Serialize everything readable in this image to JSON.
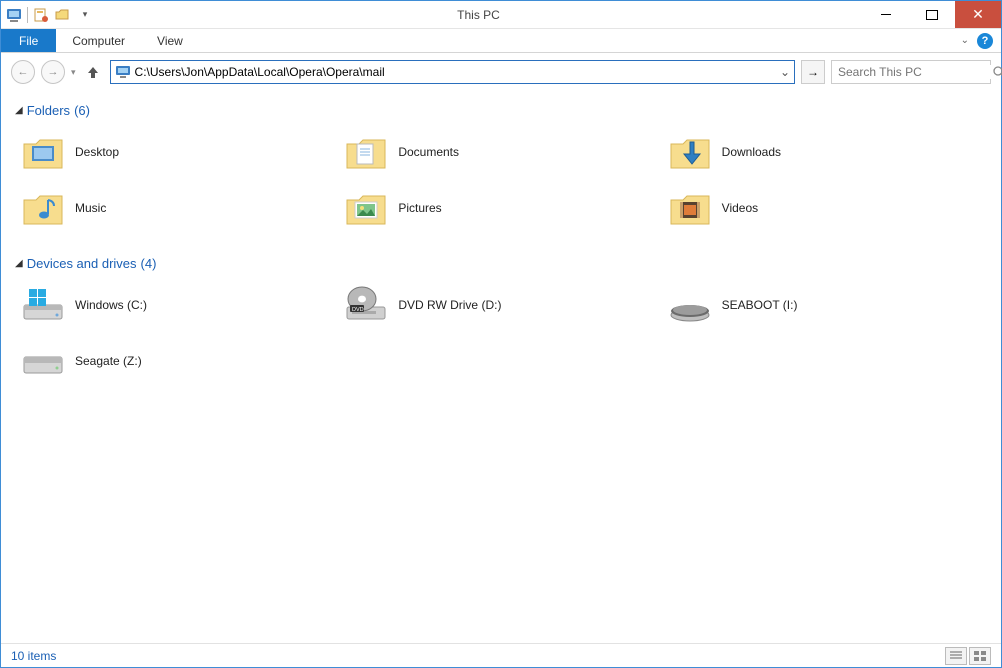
{
  "window": {
    "title": "This PC"
  },
  "ribbon": {
    "file": "File",
    "tabs": [
      "Computer",
      "View"
    ]
  },
  "address": {
    "path": "C:\\Users\\Jon\\AppData\\Local\\Opera\\Opera\\mail"
  },
  "search": {
    "placeholder": "Search This PC"
  },
  "groups": [
    {
      "title": "Folders",
      "count": "(6)",
      "items": [
        {
          "label": "Desktop",
          "icon": "desktop"
        },
        {
          "label": "Documents",
          "icon": "documents"
        },
        {
          "label": "Downloads",
          "icon": "downloads"
        },
        {
          "label": "Music",
          "icon": "music"
        },
        {
          "label": "Pictures",
          "icon": "pictures"
        },
        {
          "label": "Videos",
          "icon": "videos"
        }
      ]
    },
    {
      "title": "Devices and drives",
      "count": "(4)",
      "items": [
        {
          "label": "Windows (C:)",
          "icon": "hdd-win"
        },
        {
          "label": "DVD RW Drive (D:)",
          "icon": "dvd"
        },
        {
          "label": "SEABOOT (I:)",
          "icon": "ext"
        },
        {
          "label": "Seagate (Z:)",
          "icon": "hdd"
        }
      ]
    }
  ],
  "status": {
    "text": "10 items"
  }
}
